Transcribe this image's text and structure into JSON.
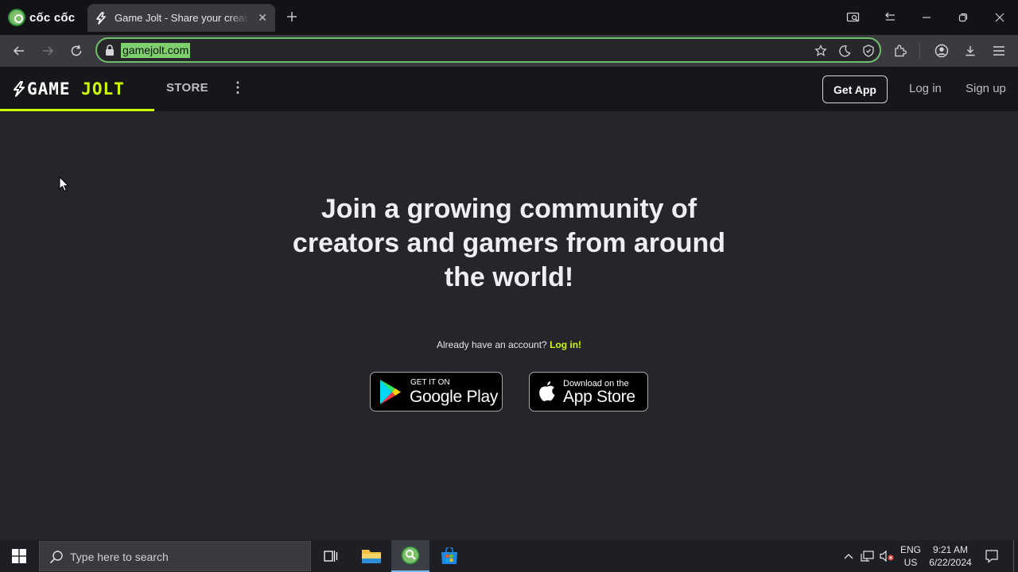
{
  "browser": {
    "brand_name": "cốc cốc",
    "tab": {
      "title": "Game Jolt - Share your creations",
      "icon": "game-jolt-bolt-icon"
    },
    "new_tab_icon": "plus-icon",
    "window_controls": [
      "screen-capture-icon",
      "back-arrow-icon",
      "minimize-icon",
      "restore-icon",
      "close-icon"
    ],
    "toolbar": {
      "url": "gamejolt.com",
      "right_icons": [
        "star-icon",
        "moon-icon",
        "shield-icon",
        "extension-icon",
        "account-icon",
        "download-icon",
        "menu-icon"
      ]
    },
    "accent_color": "#6fbf6a"
  },
  "site": {
    "logo_left": "GAME",
    "logo_right": "JOLT",
    "nav_store": "STORE",
    "nav_more": "⋮",
    "get_app": "Get App",
    "log_in": "Log in",
    "sign_up": "Sign up",
    "brand_color": "#ccff00",
    "headline": "Join a growing community of creators and gamers from around the world!",
    "already_text": "Already have an account?",
    "already_link": "Log in!",
    "google_play": {
      "small": "GET IT ON",
      "big": "Google Play"
    },
    "app_store": {
      "small": "Download on the",
      "big": "App Store"
    }
  },
  "taskbar": {
    "search_placeholder": "Type here to search",
    "apps": [
      "task-view-icon",
      "file-explorer-icon",
      "coccoc-browser-icon",
      "microsoft-store-icon"
    ],
    "lang_line1": "ENG",
    "lang_line2": "US",
    "time": "9:21 AM",
    "date": "6/22/2024"
  }
}
